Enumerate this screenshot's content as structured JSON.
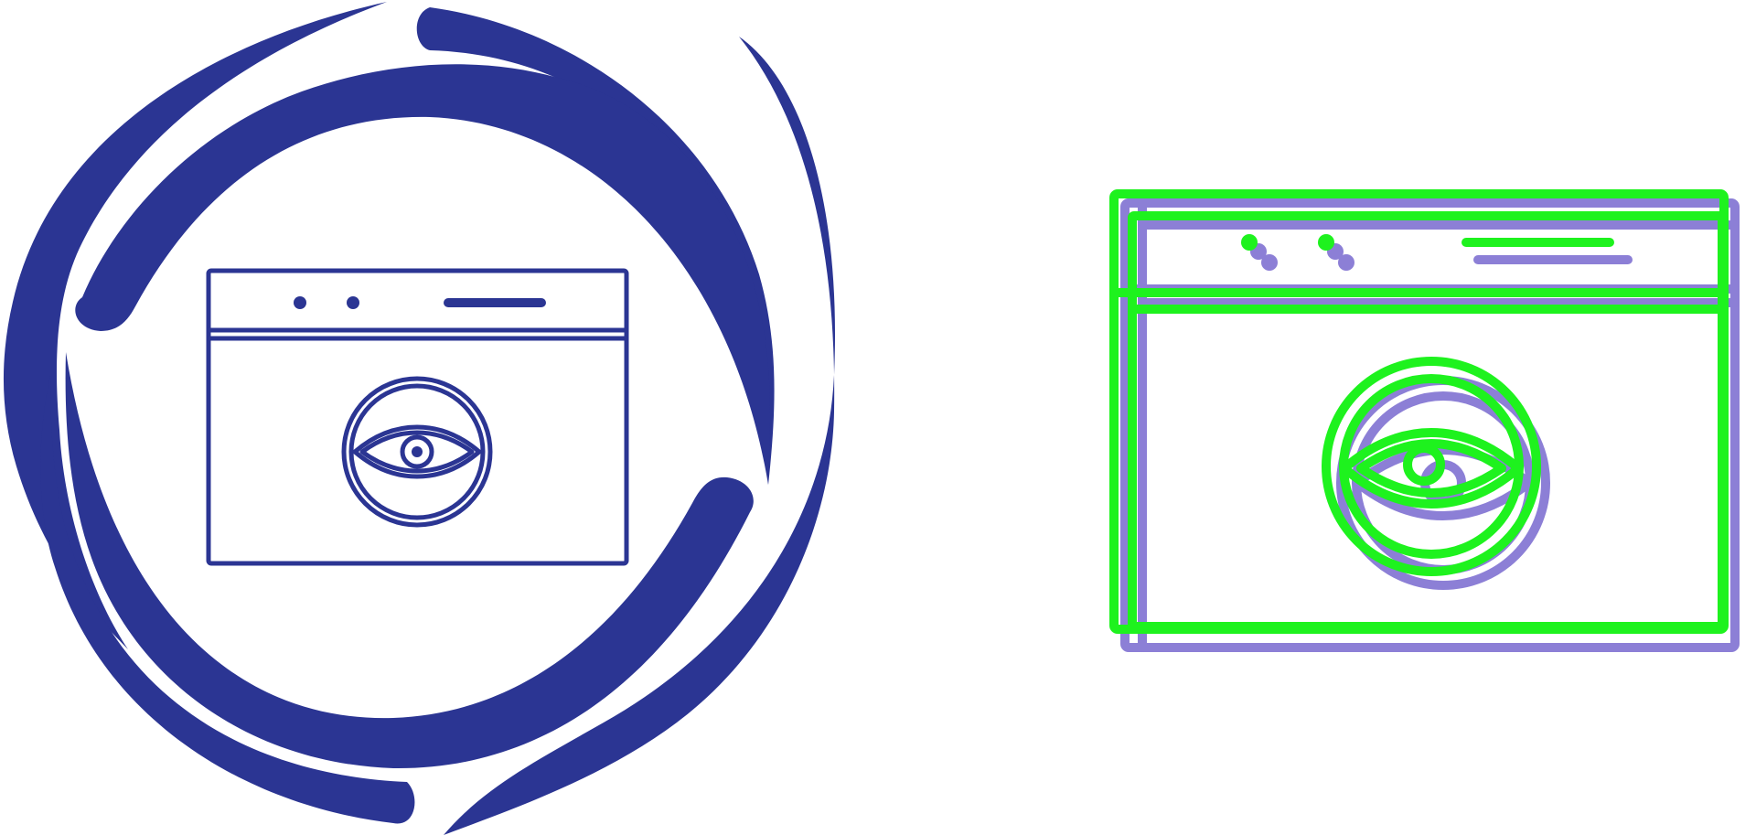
{
  "icons": [
    {
      "name": "web-monitoring-glyph-icon",
      "style": "glyph",
      "colors": {
        "primary": "#2b3593"
      }
    },
    {
      "name": "web-monitoring-duotone-icon",
      "style": "outline-duotone",
      "colors": {
        "stroke": "#1ef21e",
        "shadow": "#8c7fd6"
      }
    }
  ]
}
